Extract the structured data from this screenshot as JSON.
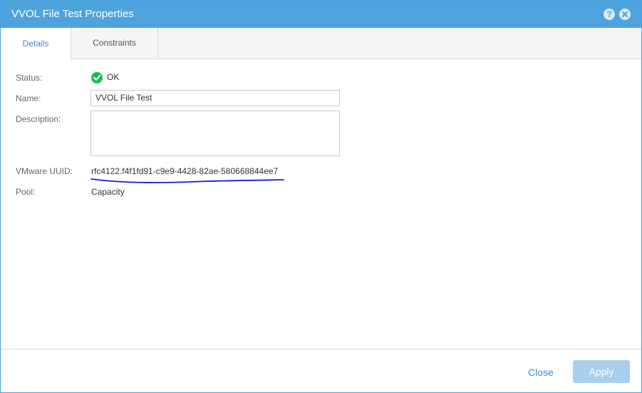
{
  "dialog": {
    "title": "VVOL File Test Properties",
    "help_icon": "question-circle-icon",
    "help_glyph": "?",
    "close_icon": "close-circle-icon",
    "accent_color": "#4ea3de"
  },
  "tabs": [
    {
      "label": "Details",
      "active": true
    },
    {
      "label": "Constraints",
      "active": false
    }
  ],
  "details": {
    "status_label": "Status:",
    "status_value": "OK",
    "status_icon": "check-circle-icon",
    "status_color": "#1db954",
    "name_label": "Name:",
    "name_value": "VVOL File Test",
    "description_label": "Description:",
    "description_value": "",
    "uuid_label": "VMware UUID:",
    "uuid_value": "rfc4122.f4f1fd91-c9e9-4428-82ae-580668844ee7",
    "pool_label": "Pool:",
    "pool_value": "Capacity"
  },
  "footer": {
    "close_label": "Close",
    "apply_label": "Apply"
  }
}
